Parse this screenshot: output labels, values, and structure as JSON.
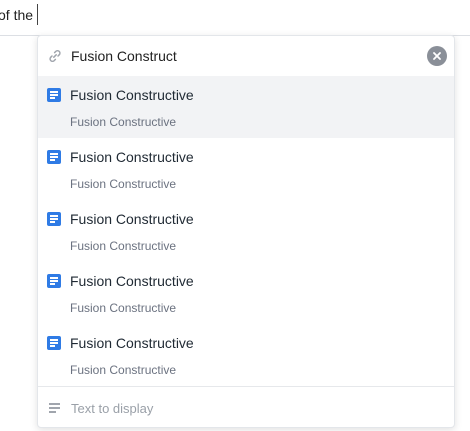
{
  "editor": {
    "text": "of the"
  },
  "link_popup": {
    "url_value": "Fusion Construct",
    "clear_icon": "close-circle-icon",
    "results": [
      {
        "title": "Fusion Constructive",
        "subtitle": "Fusion Constructive",
        "icon": "document-icon",
        "selected": true
      },
      {
        "title": "Fusion Constructive",
        "subtitle": "Fusion Constructive",
        "icon": "document-icon",
        "selected": false
      },
      {
        "title": "Fusion Constructive",
        "subtitle": "Fusion Constructive",
        "icon": "document-icon",
        "selected": false
      },
      {
        "title": "Fusion Constructive",
        "subtitle": "Fusion Constructive",
        "icon": "document-icon",
        "selected": false
      },
      {
        "title": "Fusion Constructive",
        "subtitle": "Fusion Constructive",
        "icon": "document-icon",
        "selected": false
      }
    ],
    "display_placeholder": "Text to display"
  },
  "colors": {
    "accent": "#2f7be5",
    "selected_bg": "#f2f3f5",
    "muted_text": "#6b7280"
  }
}
